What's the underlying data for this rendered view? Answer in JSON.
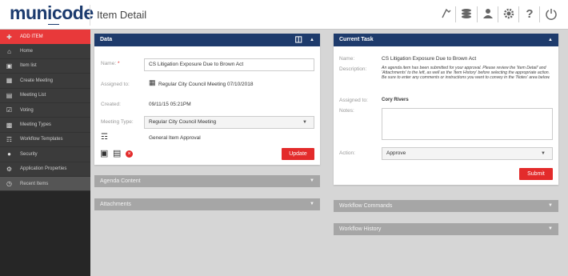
{
  "app": {
    "logo": "municode",
    "page_title": "Item Detail"
  },
  "toolbar": {
    "icons": [
      "pin-icon",
      "layers-icon",
      "user-icon",
      "gear-icon",
      "help-icon",
      "power-icon"
    ]
  },
  "sidebar": {
    "items": [
      {
        "label": "ADD ITEM"
      },
      {
        "label": "Home"
      },
      {
        "label": "Item list"
      },
      {
        "label": "Create Meeting"
      },
      {
        "label": "Meeting List"
      },
      {
        "label": "Voting"
      },
      {
        "label": "Meeting Types"
      },
      {
        "label": "Workflow Templates"
      },
      {
        "label": "Security"
      },
      {
        "label": "Application Properties"
      },
      {
        "label": "Recent Items"
      }
    ]
  },
  "data_panel": {
    "title": "Data",
    "name_label": "Name:",
    "name_required": "*",
    "name_value": "CS Litigation Exposure Due to Brown Act",
    "assigned_label": "Assigned to:",
    "assigned_value": "Regular City Council Meeting 07/10/2018",
    "created_label": "Created:",
    "created_value": "09/11/15 05:21PM",
    "meeting_type_label": "Meeting Type:",
    "meeting_type_value": "Regular City Council Meeting",
    "workflow_value": "General Item Approval",
    "update_button": "Update"
  },
  "current_task": {
    "title": "Current Task",
    "name_label": "Name:",
    "name_value": "CS Litigation Exposure Due to Brown Act",
    "description_label": "Description:",
    "description_value": "An agenda item has been submitted for your approval. Please review the 'Item Detail' and 'Attachments' to the left, as well as the 'Item History' before selecting the appropriate action. Be sure to enter any comments or instructions you want to convey in the 'Notes' area below.",
    "assigned_label": "Assigned to:",
    "assigned_value": "Cory Rivers",
    "notes_label": "Notes:",
    "action_label": "Action:",
    "action_value": "Approve",
    "submit_button": "Submit"
  },
  "sections": {
    "agenda_content": "Agenda Content",
    "attachments": "Attachments",
    "workflow_commands": "Workflow Commands",
    "workflow_history": "Workflow History"
  },
  "colors": {
    "header": "#1e3b6c",
    "accent": "#e32b2b",
    "sidebar": "#262626"
  }
}
